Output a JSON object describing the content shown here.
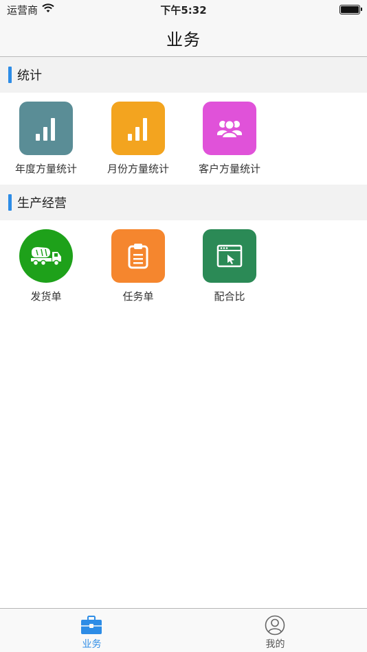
{
  "status_bar": {
    "carrier": "运营商",
    "time": "下午5:32",
    "wifi_icon": "wifi-icon",
    "battery_icon": "battery-icon"
  },
  "nav": {
    "title": "业务"
  },
  "sections": [
    {
      "title": "统计",
      "items": [
        {
          "label": "年度方量统计",
          "icon": "bar-chart-icon",
          "color": "#5a8d96"
        },
        {
          "label": "月份方量统计",
          "icon": "bar-chart-icon",
          "color": "#f3a41f"
        },
        {
          "label": "客户方量统计",
          "icon": "users-group-icon",
          "color": "#e052d9"
        }
      ]
    },
    {
      "title": "生产经营",
      "items": [
        {
          "label": "发货单",
          "icon": "concrete-mixer-truck-icon",
          "color": "#1ea11a"
        },
        {
          "label": "任务单",
          "icon": "clipboard-icon",
          "color": "#f5862e"
        },
        {
          "label": "配合比",
          "icon": "browser-window-cursor-icon",
          "color": "#2b8a56"
        }
      ]
    }
  ],
  "tab_bar": {
    "tabs": [
      {
        "label": "业务",
        "icon": "briefcase-icon",
        "active": true,
        "color": "#2d8ce6"
      },
      {
        "label": "我的",
        "icon": "user-circle-icon",
        "active": false,
        "color": "#555555"
      }
    ]
  }
}
